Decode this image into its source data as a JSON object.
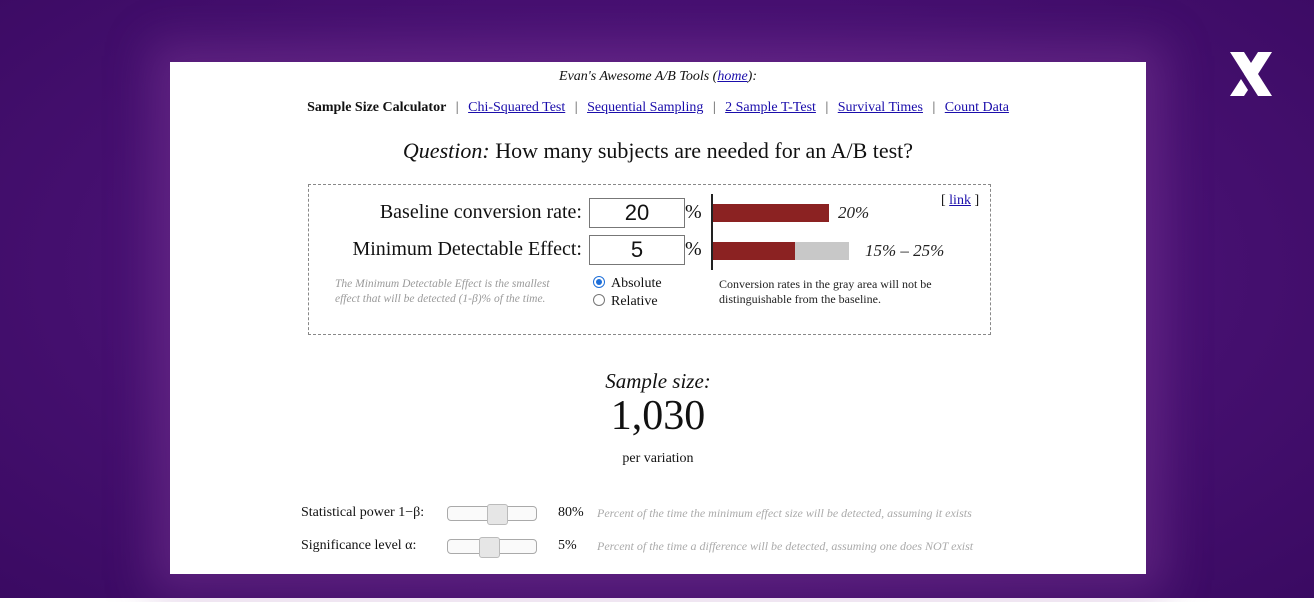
{
  "header": {
    "tools_title_prefix": "Evan's Awesome A/B Tools (",
    "tools_home_link": "home",
    "tools_title_suffix": "):"
  },
  "nav": {
    "current": "Sample Size Calculator",
    "links": [
      "Chi-Squared Test",
      "Sequential Sampling",
      "2 Sample T-Test",
      "Survival Times",
      "Count Data"
    ],
    "separator": "|"
  },
  "question": {
    "label": "Question:",
    "text": "How many subjects are needed for an A/B test?"
  },
  "inputs": {
    "baseline_label": "Baseline conversion rate:",
    "baseline_value": "20",
    "mde_label": "Minimum Detectable Effect:",
    "mde_value": "5",
    "percent_sign": "%",
    "link_prefix": "[",
    "link_text": "link",
    "link_suffix": "]"
  },
  "visual": {
    "baseline_bar_label": "20%",
    "mde_bar_label": "15% – 25%",
    "baseline_fraction": 1.0,
    "mde_red_fraction": 0.6,
    "mde_gray_fraction": 0.4,
    "red_color": "#8b2222",
    "gray_color": "#c8c8c8"
  },
  "notes": {
    "mde_note": "The Minimum Detectable Effect is the smallest effect that will be detected (1-β)% of the time.",
    "conversion_note": "Conversion rates in the gray area will not be distinguishable from the baseline."
  },
  "mode": {
    "options": [
      "Absolute",
      "Relative"
    ],
    "selected": "Absolute"
  },
  "result": {
    "label": "Sample size:",
    "value": "1,030",
    "unit": "per variation"
  },
  "sliders": [
    {
      "label": "Statistical power 1−β:",
      "value": "80%",
      "fraction": 0.57,
      "description": "Percent of the time the minimum effect size will be detected, assuming it exists"
    },
    {
      "label": "Significance level α:",
      "value": "5%",
      "fraction": 0.45,
      "description": "Percent of the time a difference will be detected, assuming one does NOT exist"
    }
  ],
  "colors": {
    "background": "#4a1275",
    "link": "#1a0dab",
    "close_icon": "#ffffff"
  },
  "icons": {
    "close": "close-x-icon"
  }
}
